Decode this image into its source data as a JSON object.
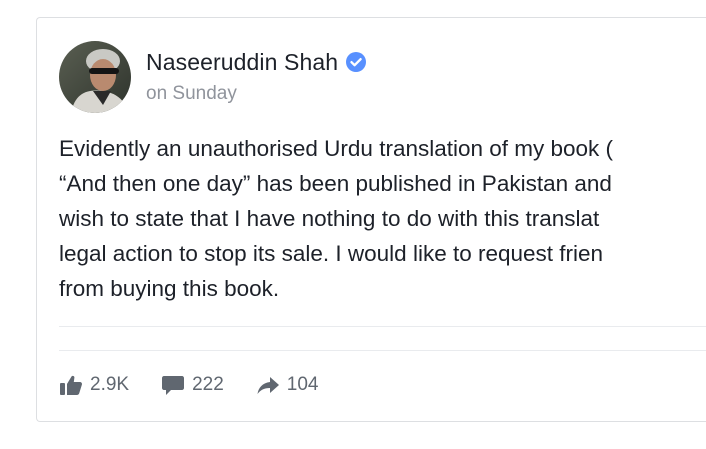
{
  "post": {
    "author": "Naseeruddin Shah",
    "time": "on Sunday",
    "lines": [
      "Evidently an unauthorised Urdu translation of my book (",
      "“And then one day” has been published in Pakistan and",
      "wish to state that I have nothing to do with this translat",
      "legal action to stop its sale. I would like to request frien",
      "from buying this book."
    ]
  },
  "stats": {
    "likes": "2.9K",
    "comments": "222",
    "shares": "104"
  },
  "icons": {
    "verified": "verified-badge-icon",
    "like": "thumbs-up-icon",
    "comment": "speech-bubble-icon",
    "share": "share-arrow-icon"
  },
  "colors": {
    "verified": "#5890ff",
    "stat_icon": "#606770",
    "text": "#1d2129",
    "muted": "#90949c"
  }
}
